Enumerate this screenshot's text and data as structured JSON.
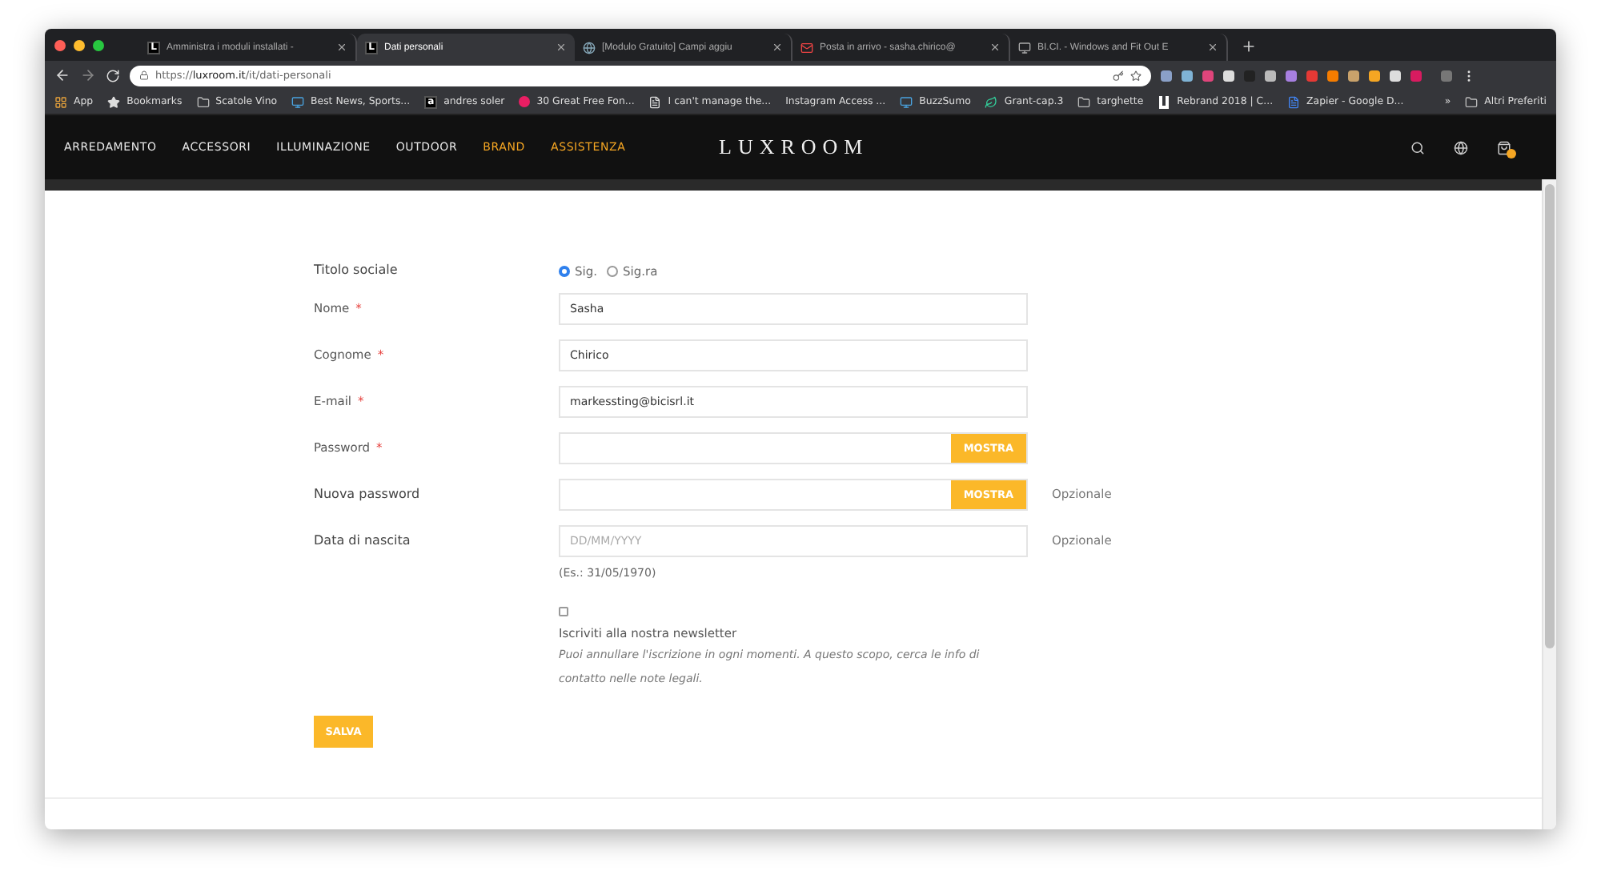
{
  "browser": {
    "tabs": [
      {
        "title": "Amministra i moduli installati -",
        "selected": false,
        "kind": "letter",
        "icon_text": "L"
      },
      {
        "title": "Dati personali",
        "selected": true,
        "kind": "letter",
        "icon_text": "L"
      },
      {
        "title": "[Modulo Gratuito] Campi aggiu",
        "selected": false,
        "kind": "globe"
      },
      {
        "title": "Posta in arrivo - sasha.chirico@",
        "selected": false,
        "kind": "mail"
      },
      {
        "title": "BI.CI. - Windows and Fit Out E",
        "selected": false,
        "kind": "page"
      }
    ],
    "url_scheme": "https://",
    "url_host": "luxroom.it",
    "url_path": "/it/dati-personali",
    "bookmarks": [
      {
        "label": "App",
        "kind": "apps"
      },
      {
        "label": "Bookmarks",
        "kind": "star"
      },
      {
        "label": "Scatole Vino",
        "kind": "folder"
      },
      {
        "label": "Best News, Sports...",
        "kind": "site"
      },
      {
        "label": "andres soler",
        "kind": "letter",
        "icon_text": "a"
      },
      {
        "label": "30 Great Free Fon...",
        "kind": "dot"
      },
      {
        "label": "I can't manage the...",
        "kind": "page"
      },
      {
        "label": "Instagram Access ...",
        "kind": "none"
      },
      {
        "label": "BuzzSumo",
        "kind": "site"
      },
      {
        "label": "Grant-cap.3",
        "kind": "leaf"
      },
      {
        "label": "targhette",
        "kind": "folder"
      },
      {
        "label": "Rebrand 2018 | C...",
        "kind": "mark"
      },
      {
        "label": "Zapier - Google D...",
        "kind": "doc"
      }
    ],
    "more": "»",
    "other_bookmarks": "Altri Preferiti"
  },
  "site": {
    "nav": [
      {
        "label": "ARREDAMENTO",
        "highlighted": false
      },
      {
        "label": "ACCESSORI",
        "highlighted": false
      },
      {
        "label": "ILLUMINAZIONE",
        "highlighted": false
      },
      {
        "label": "OUTDOOR",
        "highlighted": false
      },
      {
        "label": "BRAND",
        "highlighted": true
      },
      {
        "label": "ASSISTENZA",
        "highlighted": true
      }
    ],
    "logo": "LUXROOM"
  },
  "form": {
    "fields": [
      {
        "kind": "radio",
        "label": "Titolo sociale",
        "options": [
          {
            "label": "Sig.",
            "selected": true
          },
          {
            "label": "Sig.ra",
            "selected": false
          }
        ]
      },
      {
        "kind": "text",
        "label": "Nome",
        "required_mark": "*",
        "value": "Sasha"
      },
      {
        "kind": "text",
        "label": "Cognome",
        "required_mark": "*",
        "value": "Chirico"
      },
      {
        "kind": "text",
        "label": "E-mail",
        "required_mark": "*",
        "value": "markessting@bicisrl.it"
      },
      {
        "kind": "password",
        "label": "Password",
        "required_mark": "*",
        "button": "MOSTRA"
      },
      {
        "kind": "password",
        "label": "Nuova password",
        "button": "MOSTRA",
        "note": "Opzionale"
      },
      {
        "kind": "date",
        "label": "Data di nascita",
        "placeholder": "DD/MM/YYYY",
        "hint": "(Es.: 31/05/1970)",
        "note": "Opzionale"
      },
      {
        "kind": "checkbox",
        "checked": false,
        "label": "Iscriviti alla nostra newsletter",
        "help": "Puoi annullare l'iscrizione in ogni momenti. A questo scopo, cerca le info di contatto nelle note legali."
      }
    ],
    "submit": "SALVA"
  }
}
